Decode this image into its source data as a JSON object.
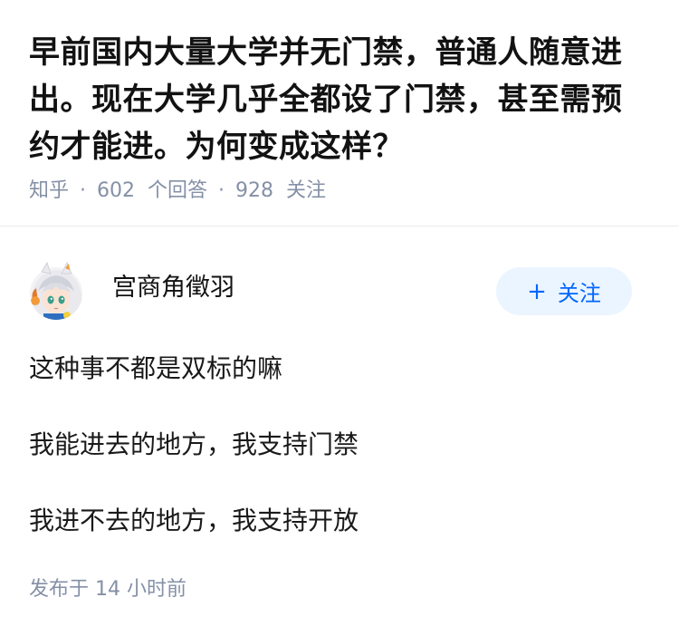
{
  "question": {
    "title": "早前国内大量大学并无门禁，普通人随意进出。现在大学几乎全都设了门禁，甚至需预约才能进。为何变成这样？",
    "source": "知乎",
    "separator": "·",
    "answer_count": "602",
    "answer_count_label": "个回答",
    "follower_count": "928",
    "follower_count_label": "关注"
  },
  "answer": {
    "author": {
      "name": "宫商角徵羽",
      "avatar_icon": "anime-avatar-icon"
    },
    "follow_button": {
      "plus": "+",
      "label": "关注"
    },
    "paragraphs": [
      "这种事不都是双标的嘛",
      "我能进去的地方，我支持门禁",
      "我进不去的地方，我支持开放"
    ],
    "published": "发布于  14 小时前"
  },
  "colors": {
    "meta_text": "#8590a6",
    "follow_button_bg": "#ebf5ff",
    "follow_button_text": "#0066ff",
    "divider": "#ebebeb"
  }
}
